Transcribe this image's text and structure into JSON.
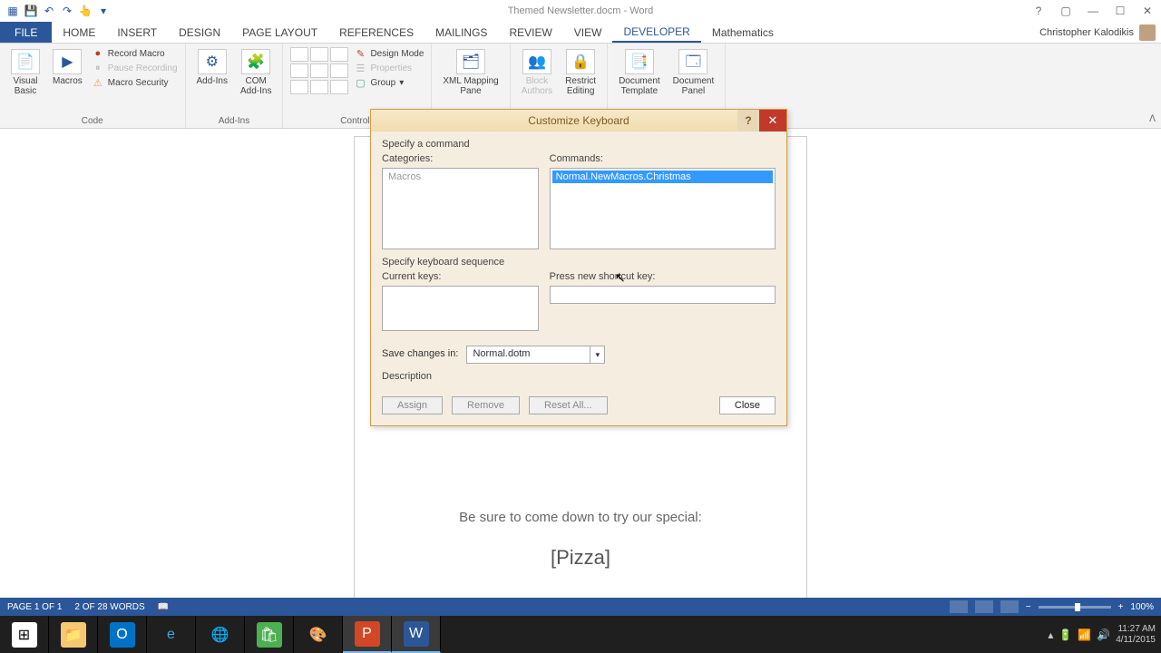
{
  "title": "Themed Newsletter.docm - Word",
  "user": "Christopher Kalodikis",
  "tabs": [
    "FILE",
    "HOME",
    "INSERT",
    "DESIGN",
    "PAGE LAYOUT",
    "REFERENCES",
    "MAILINGS",
    "REVIEW",
    "VIEW",
    "DEVELOPER",
    "Mathematics"
  ],
  "active_tab": "DEVELOPER",
  "ribbon": {
    "code": {
      "visual_basic": "Visual\nBasic",
      "macros": "Macros",
      "record": "Record Macro",
      "pause": "Pause Recording",
      "security": "Macro Security",
      "label": "Code"
    },
    "addins": {
      "addins": "Add-Ins",
      "com": "COM\nAdd-Ins",
      "label": "Add-Ins"
    },
    "controls": {
      "design": "Design Mode",
      "properties": "Properties",
      "group": "Group",
      "label": "Controls"
    },
    "mapping": {
      "xml": "XML Mapping\nPane"
    },
    "protect": {
      "block": "Block\nAuthors",
      "restrict": "Restrict\nEditing"
    },
    "templates": {
      "doc": "Document\nTemplate",
      "panel": "Document\nPanel"
    }
  },
  "document": {
    "line1": "Be sure to come down to try our special:",
    "line2": "[Pizza]"
  },
  "dialog": {
    "title": "Customize Keyboard",
    "specify_command": "Specify a command",
    "categories_label": "Categories:",
    "categories_item": "Macros",
    "commands_label": "Commands:",
    "commands_item": "Normal.NewMacros.Christmas",
    "specify_sequence": "Specify keyboard sequence",
    "current_keys": "Current keys:",
    "press_new": "Press new shortcut key:",
    "save_in_label": "Save changes in:",
    "save_in_value": "Normal.dotm",
    "description": "Description",
    "assign": "Assign",
    "remove": "Remove",
    "reset": "Reset All...",
    "close": "Close"
  },
  "status": {
    "page": "PAGE 1 OF 1",
    "words": "2 OF 28 WORDS",
    "zoom": "100%"
  },
  "tray": {
    "time": "11:27 AM",
    "date": "4/11/2015"
  }
}
